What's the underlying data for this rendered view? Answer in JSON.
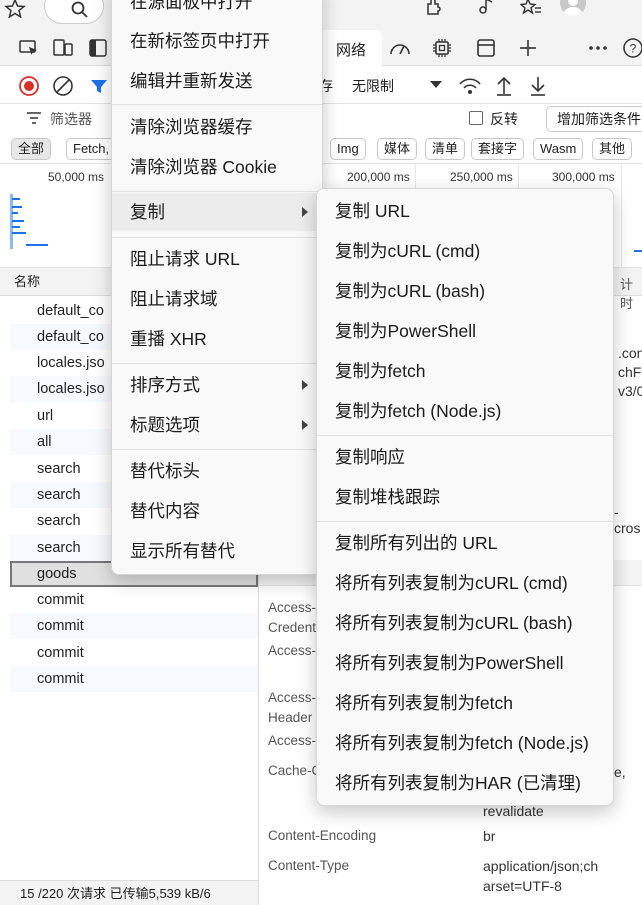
{
  "devtools": {
    "network_tab_label": "网络",
    "throttle_label": "无限制",
    "preserve_partial": "存",
    "filter_placeholder": "筛选器",
    "invert_label": "反转",
    "more_filters_label": "增加筛选条件",
    "type_filters": [
      "全部",
      "Fetch,",
      "Img",
      "媒体",
      "清单",
      "套接字",
      "Wasm",
      "其他"
    ],
    "timeline_ticks": [
      "50,000 ms",
      "200,000 ms",
      "250,000 ms",
      "300,000 ms"
    ],
    "name_column_header": "名称",
    "timing_partial": "计时",
    "requests": [
      "default_co",
      "default_co",
      "locales.jso",
      "locales.jso",
      "url",
      "all",
      "search",
      "search",
      "search",
      "search",
      "goods",
      "commit",
      "commit",
      "commit",
      "commit"
    ],
    "selected_request": "goods",
    "status_bar": "15 /220 次请求   已传输5,539 kB/6",
    "headers": {
      "names": [
        "Access-\nCredent",
        "Access-",
        "Access-\nHeader",
        "Access-",
        "Cache-C",
        "Content-Encoding",
        "Content-Type"
      ],
      "values_partial": [
        ".con",
        "chFr",
        "v3/0",
        "-cros",
        "e,",
        "revalidate",
        "br",
        "application/json;ch",
        "arset=UTF-8"
      ]
    }
  },
  "context_menu": {
    "items": [
      {
        "label": "在源面板中打开"
      },
      {
        "label": "在新标签页中打开"
      },
      {
        "label": "编辑并重新发送"
      },
      {
        "label": "清除浏览器缓存"
      },
      {
        "label": "清除浏览器 Cookie"
      },
      {
        "label": "复制",
        "submenu": true
      },
      {
        "label": "阻止请求 URL"
      },
      {
        "label": "阻止请求域"
      },
      {
        "label": "重播 XHR"
      },
      {
        "label": "排序方式",
        "submenu": true
      },
      {
        "label": "标题选项",
        "submenu": true
      },
      {
        "label": "替代标头"
      },
      {
        "label": "替代内容"
      },
      {
        "label": "显示所有替代"
      }
    ]
  },
  "copy_submenu": {
    "items": [
      "复制 URL",
      "复制为cURL (cmd)",
      "复制为cURL (bash)",
      "复制为PowerShell",
      "复制为fetch",
      "复制为fetch (Node.js)",
      "复制响应",
      "复制堆栈跟踪",
      "复制所有列出的 URL",
      "将所有列表复制为cURL (cmd)",
      "将所有列表复制为cURL (bash)",
      "将所有列表复制为PowerShell",
      "将所有列表复制为fetch",
      "将所有列表复制为fetch (Node.js)",
      "将所有列表复制为HAR (已清理)"
    ]
  }
}
